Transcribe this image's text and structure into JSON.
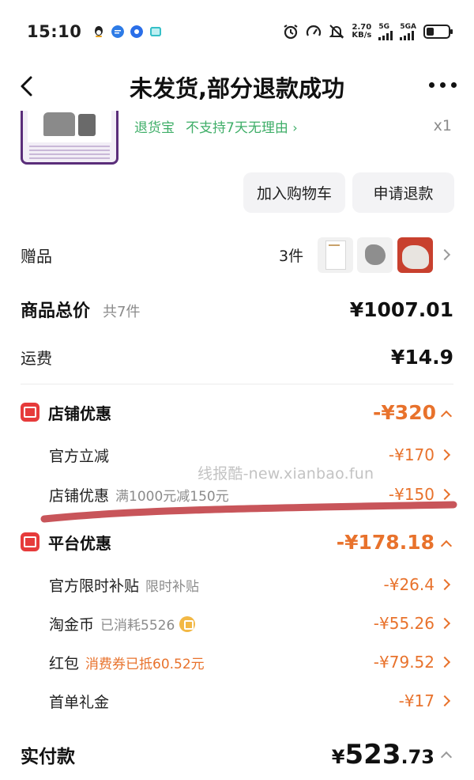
{
  "status_bar": {
    "time": "15:10",
    "net_speed": "2.70",
    "net_unit": "KB/s",
    "sig1": "5G",
    "sig2": "5GA",
    "icons": [
      "qq-icon",
      "message-icon",
      "browser-icon",
      "gallery-icon",
      "alarm-icon",
      "speed-icon",
      "mute-icon",
      "battery-icon"
    ]
  },
  "nav": {
    "title": "未发货,部分退款成功"
  },
  "product": {
    "service1": "退货宝",
    "service2": "不支持7天无理由",
    "quantity": "x1"
  },
  "actions": {
    "add_cart": "加入购物车",
    "refund": "申请退款"
  },
  "gift": {
    "label": "赠品",
    "count": "3件"
  },
  "totals": {
    "goods_label": "商品总价",
    "goods_count": "共7件",
    "goods_value": "¥1007.01",
    "shipping_label": "运费",
    "shipping_value": "¥14.9"
  },
  "store_discount": {
    "label": "店铺优惠",
    "value": "-¥320",
    "items": [
      {
        "label": "官方立减",
        "note": "",
        "value": "-¥170"
      },
      {
        "label": "店铺优惠",
        "note": "满1000元减150元",
        "value": "-¥150"
      }
    ]
  },
  "platform_discount": {
    "label": "平台优惠",
    "value": "-¥178.18",
    "items": [
      {
        "label": "官方限时补贴",
        "note": "限时补贴",
        "value": "-¥26.4"
      },
      {
        "label": "淘金币",
        "note": "已消耗5526",
        "value": "-¥55.26"
      },
      {
        "label": "红包",
        "note": "消费券已抵60.52元",
        "value": "-¥79.52"
      },
      {
        "label": "首单礼金",
        "note": "",
        "value": "-¥17"
      }
    ]
  },
  "payment": {
    "label": "实付款",
    "currency": "¥",
    "integer": "523",
    "decimal": ".73"
  },
  "watermark": "线报酷-new.xianbao.fun",
  "colors": {
    "accent_orange": "#e8722c",
    "badge_red": "#e63b3b",
    "service_green": "#3fae68",
    "annotation_red": "#c8555a"
  }
}
